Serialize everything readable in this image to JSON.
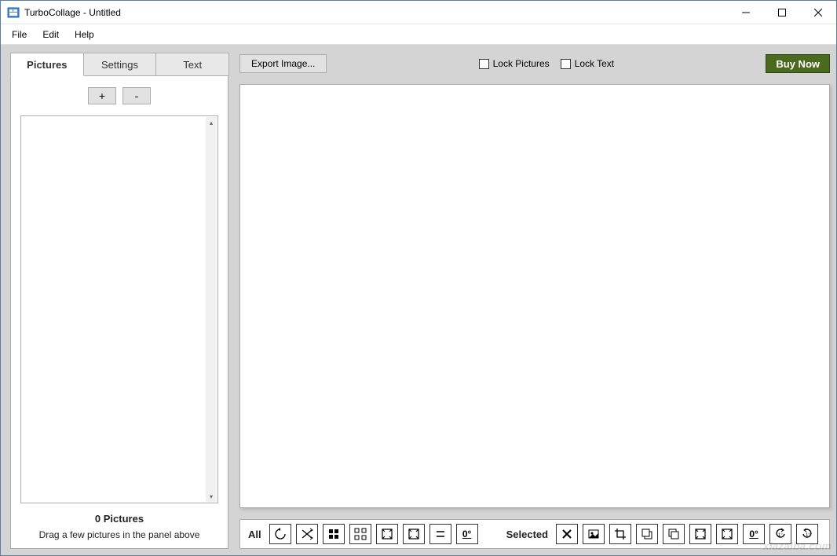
{
  "window": {
    "title": "TurboCollage - Untitled"
  },
  "menu": {
    "file": "File",
    "edit": "Edit",
    "help": "Help"
  },
  "tabs": {
    "pictures": "Pictures",
    "settings": "Settings",
    "text": "Text"
  },
  "pictures_panel": {
    "add": "+",
    "remove": "-",
    "count": "0 Pictures",
    "hint": "Drag a few pictures in the panel above"
  },
  "toolbar": {
    "export": "Export Image...",
    "lock_pictures": "Lock Pictures",
    "lock_text": "Lock Text",
    "buy": "Buy Now"
  },
  "bottom": {
    "all": "All",
    "selected": "Selected",
    "zero_deg": "0°",
    "one_deg": "1°"
  },
  "watermark": "xiazaiba.com"
}
